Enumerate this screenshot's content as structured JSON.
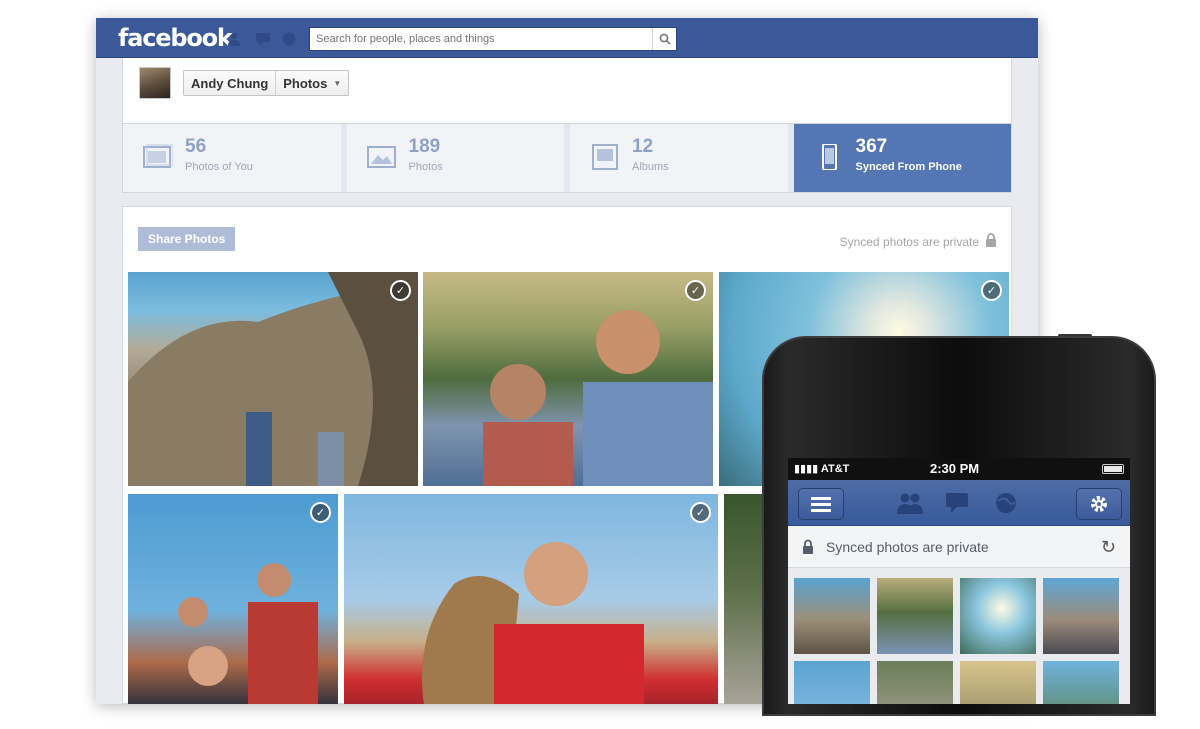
{
  "desktop": {
    "logo": "facebook",
    "search_placeholder": "Search for people, places and things",
    "profile": {
      "name": "Andy Chung",
      "section": "Photos"
    },
    "stats": [
      {
        "count": "56",
        "label": "Photos of You",
        "icon": "tagged-photos-icon"
      },
      {
        "count": "189",
        "label": "Photos",
        "icon": "photos-icon"
      },
      {
        "count": "12",
        "label": "Albums",
        "icon": "albums-icon"
      },
      {
        "count": "367",
        "label": "Synced From Phone",
        "icon": "phone-icon"
      }
    ],
    "share_button": "Share Photos",
    "private_note": "Synced photos are private",
    "photo_check_mark": "✓",
    "colors": {
      "brand": "#3b5998",
      "active_tab": "#5476b4"
    }
  },
  "phone": {
    "carrier": "AT&T",
    "time": "2:30 PM",
    "private_note": "Synced photos are private",
    "refresh_glyph": "↻"
  }
}
